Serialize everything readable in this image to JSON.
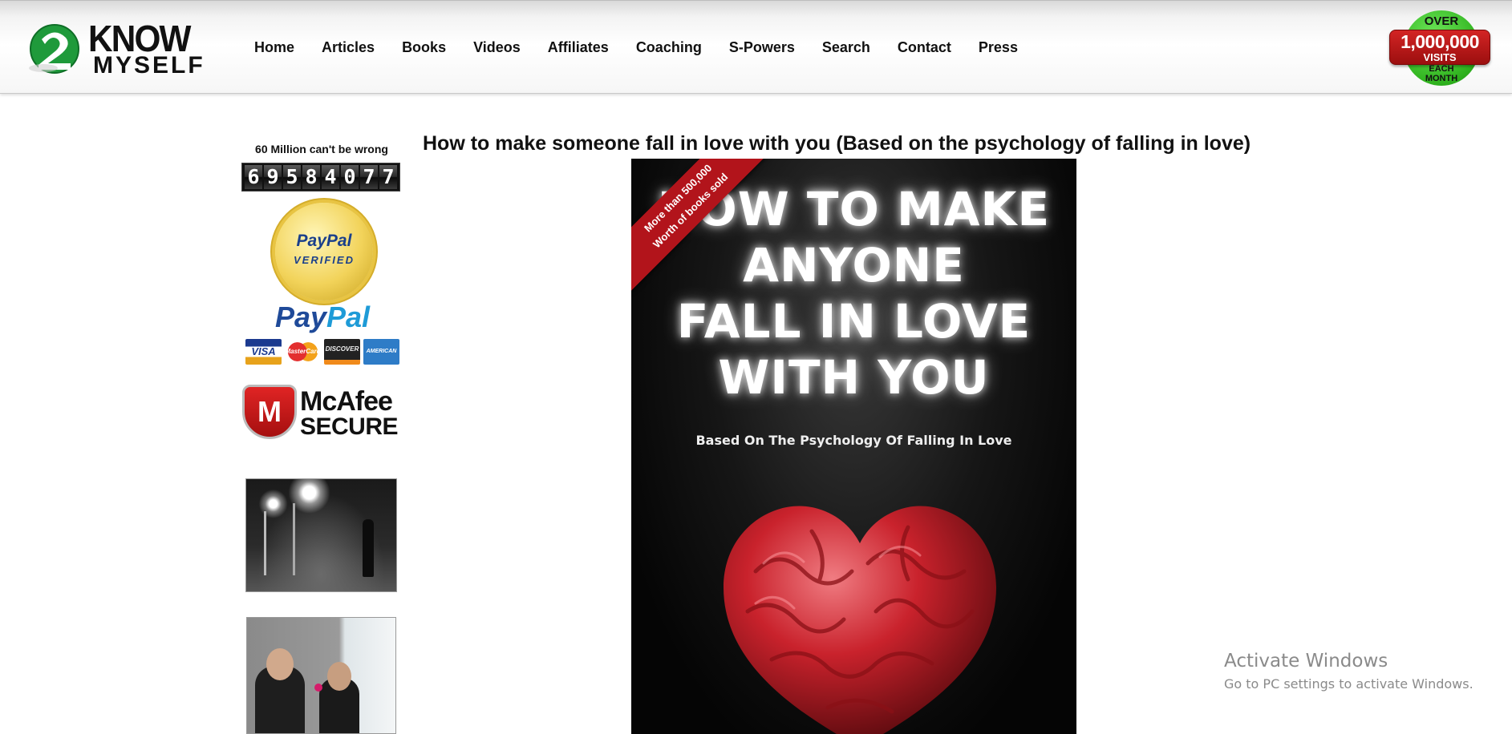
{
  "header": {
    "logo": {
      "num": "2",
      "know": "KNOW",
      "myself": "MYSELF"
    },
    "nav": [
      "Home",
      "Articles",
      "Books",
      "Videos",
      "Affiliates",
      "Coaching",
      "S-Powers",
      "Search",
      "Contact",
      "Press"
    ],
    "visits_badge": {
      "over": "OVER",
      "number": "1,000,000",
      "label": "VISITS",
      "each": "EACH",
      "month": "MONTH"
    }
  },
  "sidebar": {
    "counter_label": "60 Million can't be wrong",
    "counter_digits": [
      "6",
      "9",
      "5",
      "8",
      "4",
      "0",
      "7",
      "7"
    ],
    "paypal": {
      "seal_name": "PayPal",
      "seal_verified": "VERIFIED",
      "pay": "Pay",
      "pal": "Pal",
      "cards": [
        "VISA",
        "MasterCard",
        "DISCOVER",
        "AMERICAN EXPRESS"
      ]
    },
    "mcafee": {
      "letter": "M",
      "name": "McAfee",
      "secure": "SECURE"
    }
  },
  "main": {
    "title": "How to make someone fall in love with you (Based on the psychology of falling in love)",
    "cover": {
      "ribbon_line1": "More than 500,000",
      "ribbon_line2": "Worth of books sold",
      "title_lines": [
        "HOW TO MAKE",
        "ANYONE",
        "FALL IN LOVE",
        "WITH YOU"
      ],
      "subtitle": "Based On The Psychology Of Falling In Love"
    }
  },
  "watermark": {
    "title": "Activate Windows",
    "subtitle": "Go to PC settings to activate Windows."
  },
  "colors": {
    "brand_green": "#1f9a3b",
    "badge_red": "#b5161b",
    "badge_green": "#3fcb2a",
    "cover_red": "#b2141b"
  }
}
